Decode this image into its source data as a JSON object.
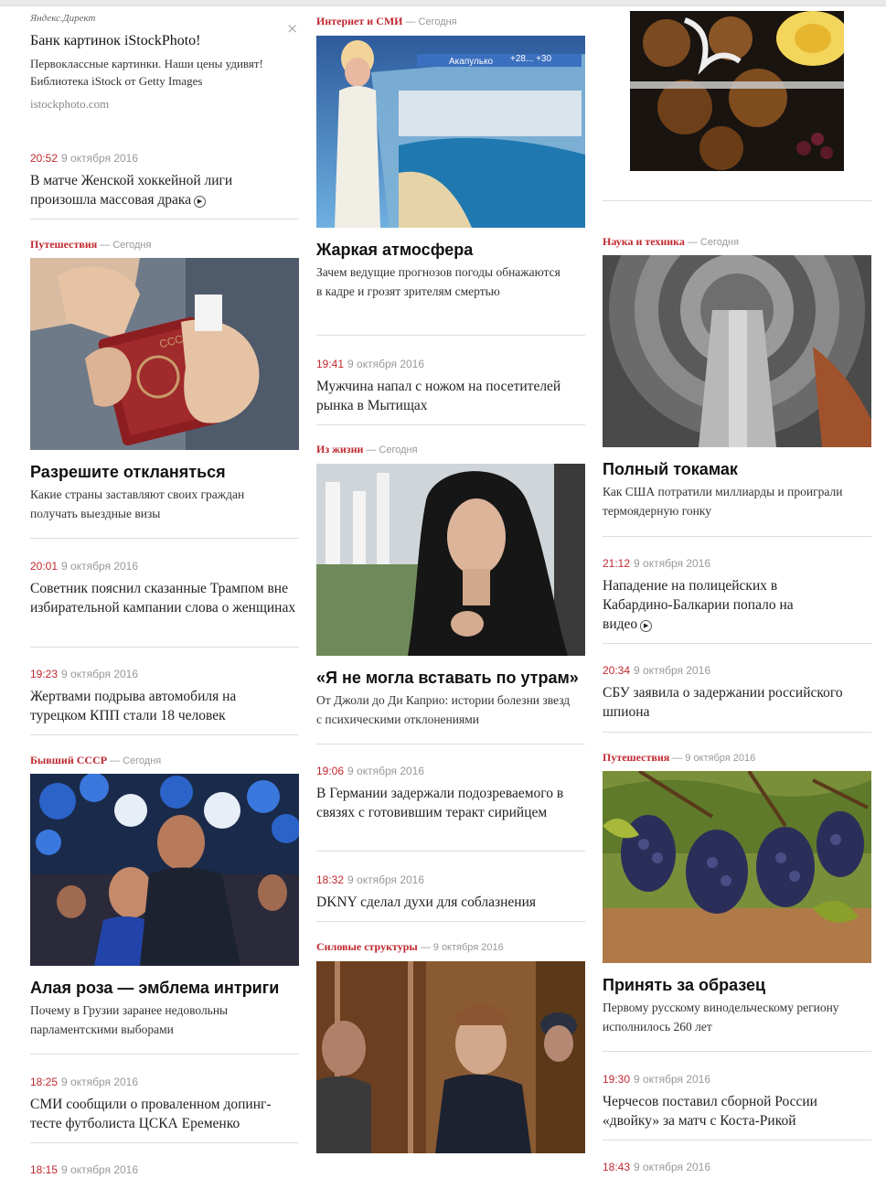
{
  "ad": {
    "label": "Яндекс.Директ",
    "title": "Банк картинок iStockPhoto!",
    "text": "Первоклассные картинки. Наши цены удивят! Библиотека iStock от Getty Images",
    "url": "istockphoto.com",
    "close": "×"
  },
  "play_glyph": "▶",
  "dash": "—",
  "col1": {
    "news1": {
      "time": "20:52",
      "date": "9 октября 2016",
      "title": "В матче Женской хоккейной лиги произошла массовая драка"
    },
    "feature1": {
      "section": "Путешествия",
      "when": "Сегодня",
      "headline": "Разрешите откланяться",
      "sub": "Какие страны заставляют своих граждан получать выездные визы"
    },
    "news2": {
      "time": "20:01",
      "date": "9 октября 2016",
      "title": "Советник пояснил сказанные Трампом вне избирательной кампании слова о женщинах"
    },
    "news3": {
      "time": "19:23",
      "date": "9 октября 2016",
      "title": "Жертвами подрыва автомобиля на турецком КПП стали 18 человек"
    },
    "feature2": {
      "section": "Бывший СССР",
      "when": "Сегодня",
      "headline": "Алая роза — эмблема интриги",
      "sub": "Почему в Грузии заранее недовольны парламентскими выборами"
    },
    "news4": {
      "time": "18:25",
      "date": "9 октября 2016",
      "title": "СМИ сообщили о проваленном допинг-тесте футболиста ЦСКА Еременко"
    },
    "news5_partial": {
      "time": "18:15",
      "date": "9 октября 2016"
    }
  },
  "col2": {
    "feature1": {
      "section": "Интернет и СМИ",
      "when": "Сегодня",
      "headline": "Жаркая атмосфера",
      "sub": "Зачем ведущие прогнозов погоды обнажаются в кадре и грозят зрителям смертью",
      "weather_city": "Акапулько",
      "weather_temps": "+28... +30"
    },
    "news1": {
      "time": "19:41",
      "date": "9 октября 2016",
      "title": "Мужчина напал с ножом на посетителей рынка в Мытищах"
    },
    "feature2": {
      "section": "Из жизни",
      "when": "Сегодня",
      "headline": "«Я не могла вставать по утрам»",
      "sub": "От Джоли до Ди Каприо: истории болезни звезд с психическими отклонениями"
    },
    "news2": {
      "time": "19:06",
      "date": "9 октября 2016",
      "title": "В Германии задержали подозреваемого в связях с готовившим теракт сирийцем"
    },
    "news3": {
      "time": "18:32",
      "date": "9 октября 2016",
      "title": "DKNY сделал духи для соблазнения"
    },
    "feature3": {
      "section": "Силовые структуры",
      "when": "9 октября 2016"
    }
  },
  "col3": {
    "feature1": {
      "section": "Наука и техника",
      "when": "Сегодня",
      "headline": "Полный токамак",
      "sub": "Как США потратили миллиарды и проиграли термоядерную гонку"
    },
    "news1": {
      "time": "21:12",
      "date": "9 октября 2016",
      "title": "Нападение на полицейских в Кабардино-Балкарии попало на видео"
    },
    "news2": {
      "time": "20:34",
      "date": "9 октября 2016",
      "title": "СБУ заявила о задержании российского шпиона"
    },
    "feature2": {
      "section": "Путешествия",
      "when": "9 октября 2016",
      "headline": "Принять за образец",
      "sub": "Первому русскому винодельческому региону исполнилось 260 лет"
    },
    "news3": {
      "time": "19:30",
      "date": "9 октября 2016",
      "title": "Черчесов поставил сборной России «двойку» за матч с Коста-Рикой"
    },
    "news4_partial": {
      "time": "18:43",
      "date": "9 октября 2016"
    }
  }
}
